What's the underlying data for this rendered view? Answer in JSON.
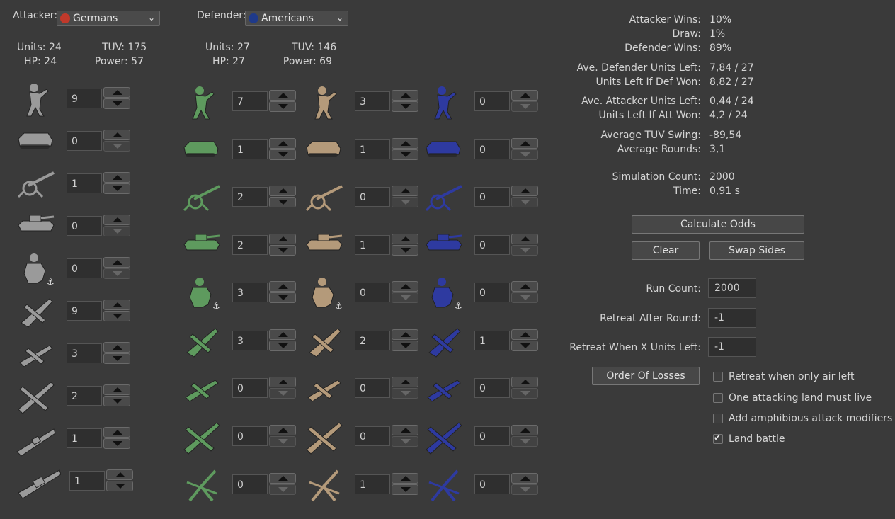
{
  "attacker": {
    "label": "Attacker:",
    "nation": "Germans",
    "units": "Units: 24",
    "tuv": "TUV: 175",
    "hp": "HP: 24",
    "power": "Power: 57"
  },
  "defender": {
    "label": "Defender:",
    "nation": "Americans",
    "units": "Units: 27",
    "tuv": "TUV: 146",
    "hp": "HP: 27",
    "power": "Power: 69"
  },
  "attacker_counts": [
    "9",
    "0",
    "1",
    "0",
    "0",
    "9",
    "3",
    "2",
    "1",
    "1"
  ],
  "defender_counts": {
    "green": [
      "7",
      "1",
      "2",
      "2",
      "3",
      "3",
      "0",
      "0",
      "0"
    ],
    "tan": [
      "3",
      "1",
      "0",
      "1",
      "0",
      "2",
      "0",
      "0",
      "1"
    ],
    "blue": [
      "0",
      "0",
      "0",
      "0",
      "0",
      "1",
      "0",
      "0",
      "0"
    ]
  },
  "stats": {
    "attacker_wins_label": "Attacker Wins:",
    "attacker_wins": "10%",
    "draw_label": "Draw:",
    "draw": "1%",
    "defender_wins_label": "Defender Wins:",
    "defender_wins": "89%",
    "ave_def_left_label": "Ave. Defender Units Left:",
    "ave_def_left": "7,84 / 27",
    "def_won_left_label": "Units Left If Def Won:",
    "def_won_left": "8,82 / 27",
    "ave_att_left_label": "Ave. Attacker Units Left:",
    "ave_att_left": "0,44 / 24",
    "att_won_left_label": "Units Left If Att Won:",
    "att_won_left": "4,2 / 24",
    "tuv_swing_label": "Average TUV Swing:",
    "tuv_swing": "-89,54",
    "rounds_label": "Average Rounds:",
    "rounds": "3,1",
    "sim_count_label": "Simulation Count:",
    "sim_count": "2000",
    "time_label": "Time:",
    "time": "0,91 s"
  },
  "buttons": {
    "calculate": "Calculate Odds",
    "clear": "Clear",
    "swap": "Swap Sides",
    "order": "Order Of Losses"
  },
  "options": {
    "run_count_label": "Run Count:",
    "run_count": "2000",
    "retreat_round_label": "Retreat After Round:",
    "retreat_round": "-1",
    "retreat_units_label": "Retreat When X Units Left:",
    "retreat_units": "-1"
  },
  "checks": {
    "air_left": "Retreat when only air left",
    "one_land": "One attacking land must live",
    "amphib": "Add amphibious attack modifiers",
    "land_battle": "Land battle"
  },
  "colors": {
    "german": "#9a9a9a",
    "green": "#5e9a5e",
    "tan": "#b49a7a",
    "blue": "#2e3aa0"
  }
}
